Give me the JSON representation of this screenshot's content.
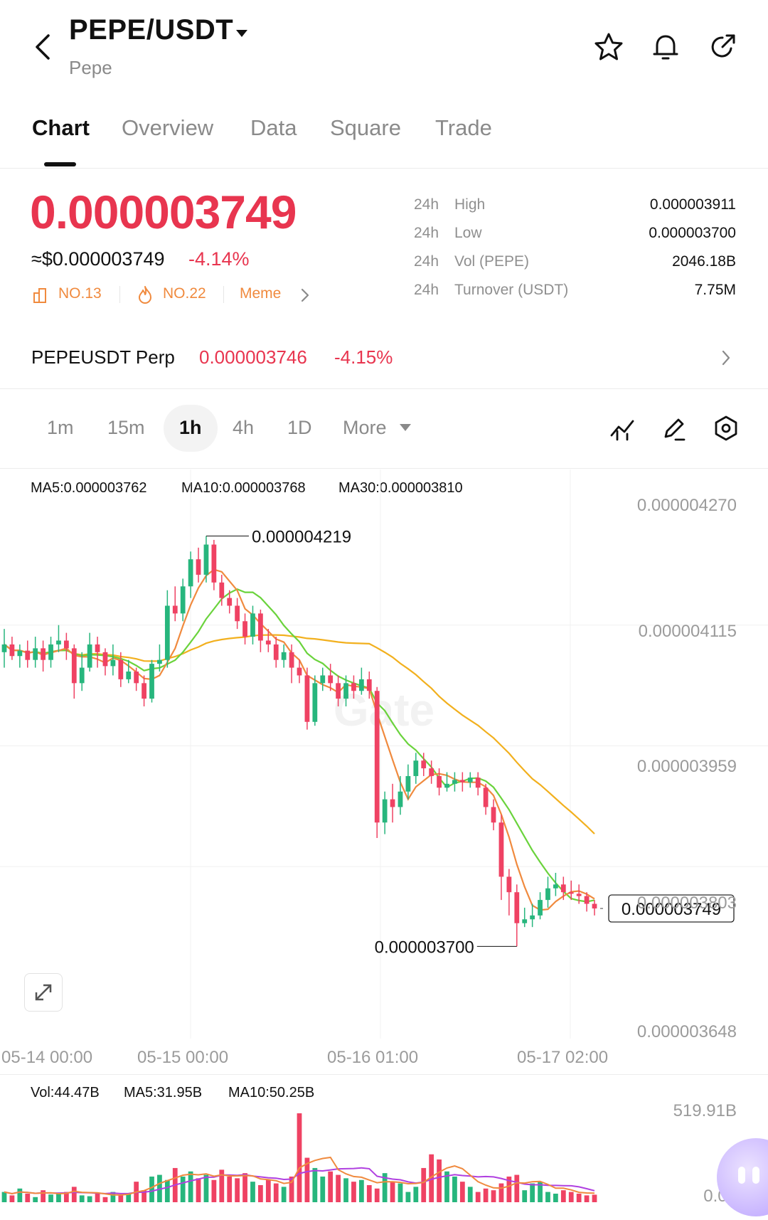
{
  "header": {
    "pair": "PEPE/USDT",
    "subtitle": "Pepe",
    "icons": [
      "back-icon",
      "caret-down-icon",
      "star-icon",
      "bell-icon",
      "share-icon"
    ]
  },
  "tabs": [
    {
      "label": "Chart",
      "active": true
    },
    {
      "label": "Overview",
      "active": false
    },
    {
      "label": "Data",
      "active": false
    },
    {
      "label": "Square",
      "active": false
    },
    {
      "label": "Trade",
      "active": false
    }
  ],
  "price": {
    "last": "0.000003749",
    "usd": "≈$0.000003749",
    "change_pct": "-4.14%",
    "tags": [
      {
        "icon": "rank-icon",
        "label": "NO.13"
      },
      {
        "icon": "fire-icon",
        "label": "NO.22"
      },
      {
        "icon": "",
        "label": "Meme"
      }
    ]
  },
  "stats": [
    {
      "period": "24h",
      "label": "High",
      "value": "0.000003911"
    },
    {
      "period": "24h",
      "label": "Low",
      "value": "0.000003700"
    },
    {
      "period": "24h",
      "label": "Vol (PEPE)",
      "value": "2046.18B"
    },
    {
      "period": "24h",
      "label": "Turnover (USDT)",
      "value": "7.75M"
    }
  ],
  "perp": {
    "name": "PEPEUSDT Perp",
    "price": "0.000003746",
    "change_pct": "-4.15%"
  },
  "intervals": [
    {
      "label": "1m",
      "active": false
    },
    {
      "label": "15m",
      "active": false
    },
    {
      "label": "1h",
      "active": true
    },
    {
      "label": "4h",
      "active": false
    },
    {
      "label": "1D",
      "active": false
    },
    {
      "label": "More",
      "active": false
    }
  ],
  "chart_tools": [
    "indicator-icon",
    "draw-pen-icon",
    "settings-hexagon-icon"
  ],
  "colors": {
    "up": "#27b67d",
    "down": "#ef4263",
    "ma5": "#f08a3e",
    "ma10": "#6ad33c",
    "ma30": "#f2b01e",
    "vol_ma10": "#b040e0"
  },
  "chart_data": {
    "type": "candlestick",
    "ma_legend": [
      {
        "name": "MA5",
        "text": "MA5:0.000003762",
        "color": "#f08a3e"
      },
      {
        "name": "MA10",
        "text": "MA10:0.000003768",
        "color": "#6ad33c"
      },
      {
        "name": "MA30",
        "text": "MA30:0.000003810",
        "color": "#f2b01e"
      }
    ],
    "y_ticks": [
      "0.000004270",
      "0.000004115",
      "0.000003959",
      "0.000003803",
      "0.000003648"
    ],
    "y_range": [
      3.648e-06,
      4.27e-06
    ],
    "x_ticks": [
      "05-14 00:00",
      "05-15 00:00",
      "05-16 01:00",
      "05-17 02:00"
    ],
    "high_label": "0.000004219",
    "low_label": "0.000003700",
    "last_label": "0.000003749",
    "watermark": "Gate",
    "candles": [
      [
        4.08,
        4.09,
        4.11,
        4.06
      ],
      [
        4.09,
        4.075,
        4.1,
        4.07
      ],
      [
        4.075,
        4.082,
        4.09,
        4.06
      ],
      [
        4.082,
        4.07,
        4.095,
        4.06
      ],
      [
        4.07,
        4.085,
        4.1,
        4.06
      ],
      [
        4.085,
        4.07,
        4.095,
        4.055
      ],
      [
        4.07,
        4.09,
        4.1,
        4.06
      ],
      [
        4.09,
        4.095,
        4.115,
        4.08
      ],
      [
        4.095,
        4.085,
        4.105,
        4.07
      ],
      [
        4.085,
        4.04,
        4.09,
        4.02
      ],
      [
        4.04,
        4.06,
        4.08,
        4.03
      ],
      [
        4.06,
        4.09,
        4.105,
        4.055
      ],
      [
        4.09,
        4.08,
        4.1,
        4.06
      ],
      [
        4.08,
        4.062,
        4.085,
        4.05
      ],
      [
        4.062,
        4.07,
        4.09,
        4.05
      ],
      [
        4.07,
        4.045,
        4.08,
        4.035
      ],
      [
        4.045,
        4.055,
        4.07,
        4.04
      ],
      [
        4.055,
        4.04,
        4.06,
        4.03
      ],
      [
        4.04,
        4.02,
        4.05,
        4.01
      ],
      [
        4.02,
        4.065,
        4.07,
        4.015
      ],
      [
        4.065,
        4.07,
        4.09,
        4.055
      ],
      [
        4.07,
        4.14,
        4.16,
        4.06
      ],
      [
        4.14,
        4.13,
        4.165,
        4.12
      ],
      [
        4.13,
        4.165,
        4.175,
        4.12
      ],
      [
        4.165,
        4.2,
        4.21,
        4.15
      ],
      [
        4.2,
        4.18,
        4.215,
        4.17
      ],
      [
        4.18,
        4.219,
        4.23,
        4.17
      ],
      [
        4.219,
        4.17,
        4.225,
        4.16
      ],
      [
        4.17,
        4.15,
        4.18,
        4.14
      ],
      [
        4.15,
        4.14,
        4.16,
        4.13
      ],
      [
        4.14,
        4.12,
        4.15,
        4.11
      ],
      [
        4.12,
        4.1,
        4.13,
        4.09
      ],
      [
        4.1,
        4.13,
        4.14,
        4.09
      ],
      [
        4.13,
        4.095,
        4.135,
        4.08
      ],
      [
        4.095,
        4.09,
        4.11,
        4.08
      ],
      [
        4.09,
        4.07,
        4.1,
        4.06
      ],
      [
        4.07,
        4.08,
        4.09,
        4.06
      ],
      [
        4.08,
        4.06,
        4.09,
        4.04
      ],
      [
        4.06,
        4.05,
        4.07,
        4.04
      ],
      [
        4.05,
        3.99,
        4.06,
        3.98
      ],
      [
        3.99,
        4.04,
        4.05,
        3.985
      ],
      [
        4.04,
        4.05,
        4.06,
        4.03
      ],
      [
        4.05,
        4.04,
        4.065,
        4.03
      ],
      [
        4.04,
        4.02,
        4.05,
        4.01
      ],
      [
        4.02,
        4.04,
        4.05,
        4.01
      ],
      [
        4.04,
        4.03,
        4.05,
        4.02
      ],
      [
        4.03,
        4.045,
        4.06,
        4.025
      ],
      [
        4.045,
        4.03,
        4.055,
        4.02
      ],
      [
        4.03,
        3.86,
        4.035,
        3.84
      ],
      [
        3.86,
        3.89,
        3.9,
        3.845
      ],
      [
        3.89,
        3.88,
        3.91,
        3.86
      ],
      [
        3.88,
        3.9,
        3.92,
        3.87
      ],
      [
        3.9,
        3.92,
        3.935,
        3.89
      ],
      [
        3.92,
        3.94,
        3.95,
        3.91
      ],
      [
        3.94,
        3.93,
        3.95,
        3.92
      ],
      [
        3.93,
        3.92,
        3.94,
        3.91
      ],
      [
        3.92,
        3.905,
        3.93,
        3.895
      ],
      [
        3.905,
        3.91,
        3.925,
        3.9
      ],
      [
        3.91,
        3.915,
        3.925,
        3.9
      ],
      [
        3.915,
        3.912,
        3.925,
        3.9
      ],
      [
        3.912,
        3.918,
        3.925,
        3.905
      ],
      [
        3.918,
        3.905,
        3.925,
        3.895
      ],
      [
        3.905,
        3.88,
        3.91,
        3.87
      ],
      [
        3.88,
        3.86,
        3.89,
        3.85
      ],
      [
        3.86,
        3.79,
        3.87,
        3.76
      ],
      [
        3.79,
        3.77,
        3.8,
        3.74
      ],
      [
        3.77,
        3.73,
        3.78,
        3.7
      ],
      [
        3.73,
        3.735,
        3.75,
        3.725
      ],
      [
        3.735,
        3.74,
        3.755,
        3.725
      ],
      [
        3.74,
        3.76,
        3.77,
        3.735
      ],
      [
        3.76,
        3.775,
        3.79,
        3.75
      ],
      [
        3.775,
        3.78,
        3.795,
        3.765
      ],
      [
        3.78,
        3.77,
        3.79,
        3.76
      ],
      [
        3.77,
        3.768,
        3.785,
        3.76
      ],
      [
        3.768,
        3.765,
        3.78,
        3.755
      ],
      [
        3.765,
        3.755,
        3.77,
        3.745
      ],
      [
        3.755,
        3.749,
        3.76,
        3.74
      ]
    ],
    "volume_legend": [
      {
        "text": "Vol:44.47B",
        "color": "#f2b01e"
      },
      {
        "text": "MA5:31.95B",
        "color": "#f08a3e"
      },
      {
        "text": "MA10:50.25B",
        "color": "#b040e0"
      }
    ],
    "volume_y_ticks": [
      "519.91B",
      "0.00"
    ],
    "volume_values": [
      60,
      40,
      80,
      50,
      30,
      70,
      45,
      55,
      60,
      90,
      40,
      35,
      50,
      30,
      60,
      40,
      50,
      120,
      70,
      150,
      160,
      130,
      200,
      150,
      180,
      140,
      160,
      130,
      190,
      150,
      140,
      170,
      120,
      100,
      130,
      110,
      90,
      150,
      520,
      260,
      200,
      150,
      180,
      160,
      140,
      120,
      130,
      100,
      80,
      170,
      120,
      110,
      60,
      90,
      200,
      280,
      250,
      180,
      150,
      120,
      90,
      60,
      80,
      70,
      110,
      150,
      160,
      70,
      110,
      120,
      60,
      50,
      70,
      60,
      50,
      40,
      44
    ]
  }
}
